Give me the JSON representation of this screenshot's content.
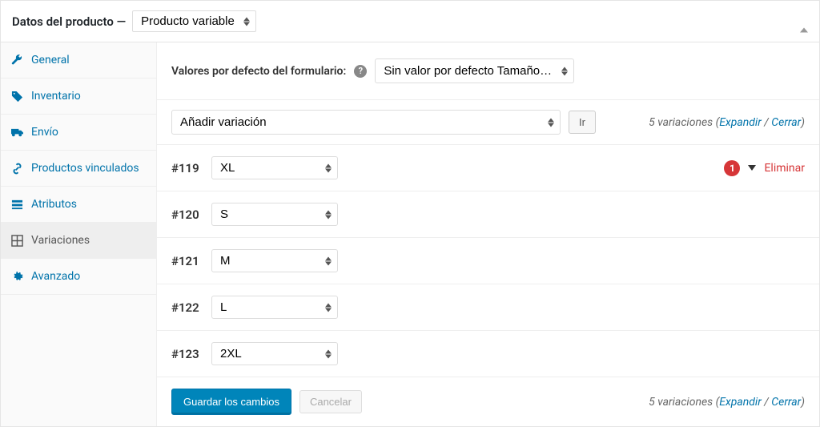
{
  "header": {
    "title": "Datos del producto —",
    "product_type": "Producto variable"
  },
  "sidebar": {
    "items": [
      {
        "label": "General"
      },
      {
        "label": "Inventario"
      },
      {
        "label": "Envío"
      },
      {
        "label": "Productos vinculados"
      },
      {
        "label": "Atributos"
      },
      {
        "label": "Variaciones"
      },
      {
        "label": "Avanzado"
      }
    ]
  },
  "defaults": {
    "label": "Valores por defecto del formulario:",
    "option": "Sin valor por defecto Tamaño…"
  },
  "action_bar": {
    "add_variation": "Añadir variación",
    "go": "Ir",
    "count_prefix": "5 variaciones (",
    "expand": "Expandir",
    "sep": " / ",
    "close": "Cerrar",
    "count_suffix": ")"
  },
  "variations": [
    {
      "id": "#119",
      "size": "XL",
      "badge": "1",
      "delete": "Eliminar",
      "show_actions": true
    },
    {
      "id": "#120",
      "size": "S",
      "show_actions": false
    },
    {
      "id": "#121",
      "size": "M",
      "show_actions": false
    },
    {
      "id": "#122",
      "size": "L",
      "show_actions": false
    },
    {
      "id": "#123",
      "size": "2XL",
      "show_actions": false
    }
  ],
  "footer": {
    "save": "Guardar los cambios",
    "cancel": "Cancelar"
  }
}
